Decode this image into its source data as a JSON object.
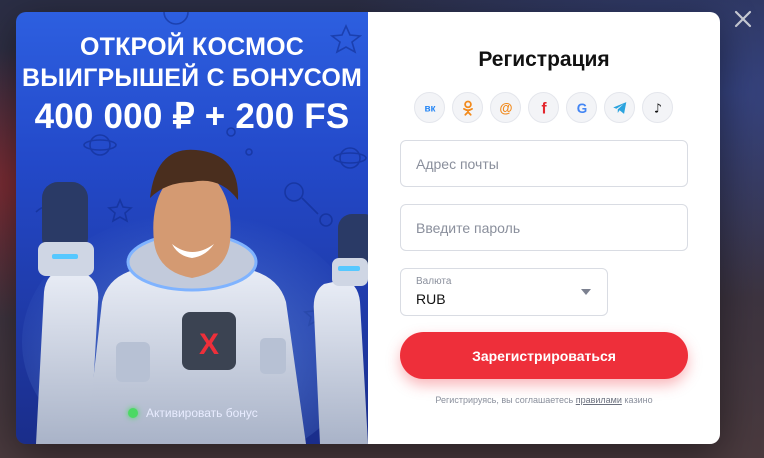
{
  "promo": {
    "line1": "ОТКРОЙ КОСМОС",
    "line2": "ВЫИГРЫШЕЙ С БОНУСОМ",
    "line3": "400 000 ₽ + 200 FS",
    "activate_label": "Активировать бонус",
    "suit_logo": "X"
  },
  "form": {
    "title": "Регистрация",
    "socials": [
      {
        "name": "vk-icon",
        "glyph": "вк",
        "color": "#2787f5"
      },
      {
        "name": "odnoklassniki-icon",
        "color": "#f28a1c"
      },
      {
        "name": "mail-at-icon",
        "glyph": "@",
        "color": "#f28a1c"
      },
      {
        "name": "facebook-icon",
        "glyph": "f",
        "color": "#e3262d"
      },
      {
        "name": "google-icon",
        "glyph": "G",
        "color": "#4285f4"
      },
      {
        "name": "telegram-icon",
        "color": "#2aa3de"
      },
      {
        "name": "tiktok-icon",
        "glyph": "♪",
        "color": "#111111"
      }
    ],
    "email_placeholder": "Адрес почты",
    "password_placeholder": "Введите пароль",
    "currency_label": "Валюта",
    "currency_value": "RUB",
    "submit_label": "Зарегистрироваться",
    "terms_prefix": "Регистрируясь, вы соглашаетесь",
    "terms_link": "правилами",
    "terms_suffix": "казино"
  },
  "colors": {
    "accent": "#ee2f3a",
    "promo_blue": "#2349c9"
  }
}
